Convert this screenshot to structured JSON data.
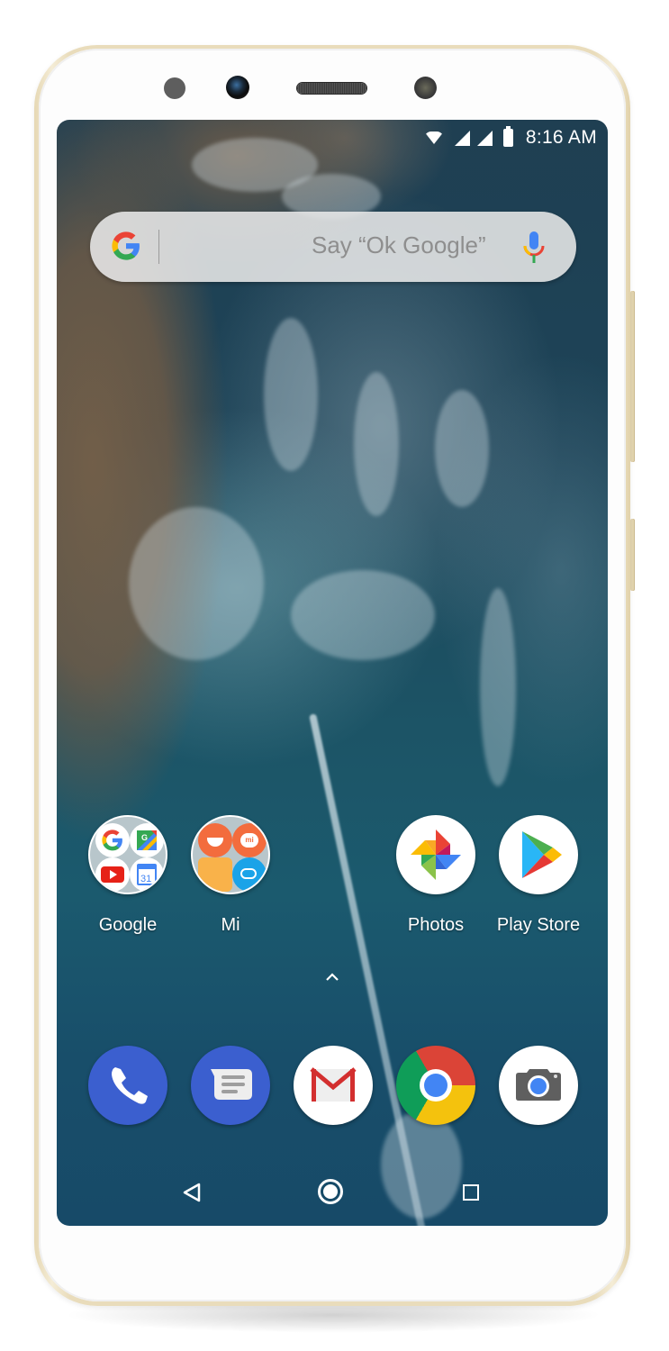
{
  "device": {
    "name": "Android phone home screen",
    "body_color": "#e9dcbb"
  },
  "status_bar": {
    "icons": [
      "wifi-icon",
      "cell-signal-icon",
      "cell-signal-icon",
      "battery-icon"
    ],
    "time": "8:16 AM"
  },
  "search_widget": {
    "logo": "google-g-icon",
    "placeholder": "Say “Ok Google”",
    "voice_icon": "microphone-icon"
  },
  "home_apps": [
    {
      "label": "Google",
      "type": "folder",
      "contents": [
        "google-search-icon",
        "google-maps-icon",
        "youtube-icon",
        "google-calendar-icon"
      ],
      "calendar_day": "31"
    },
    {
      "label": "Mi",
      "type": "folder",
      "contents": [
        "mi-community-icon",
        "mi-store-icon",
        "file-manager-icon",
        "mi-drop-icon"
      ],
      "mi_badge": "mi"
    },
    {
      "label": "Photos",
      "type": "app",
      "icon": "google-photos-icon"
    },
    {
      "label": "Play Store",
      "type": "app",
      "icon": "play-store-icon"
    }
  ],
  "app_drawer_handle": "chevron-up-icon",
  "dock": [
    {
      "name": "Phone",
      "icon": "phone-icon",
      "color": "#3b5fcf"
    },
    {
      "name": "Messages",
      "icon": "messages-icon",
      "color": "#3b5fcf"
    },
    {
      "name": "Gmail",
      "icon": "gmail-icon",
      "color": "#ffffff"
    },
    {
      "name": "Chrome",
      "icon": "chrome-icon",
      "color": "#db4437"
    },
    {
      "name": "Camera",
      "icon": "camera-icon",
      "color": "#ffffff"
    }
  ],
  "nav_bar": {
    "back": "back-icon",
    "home": "home-icon",
    "recents": "recents-icon"
  },
  "colors": {
    "google_blue": "#4285f4",
    "google_red": "#ea4335",
    "google_yellow": "#fbbc05",
    "google_green": "#34a853"
  }
}
